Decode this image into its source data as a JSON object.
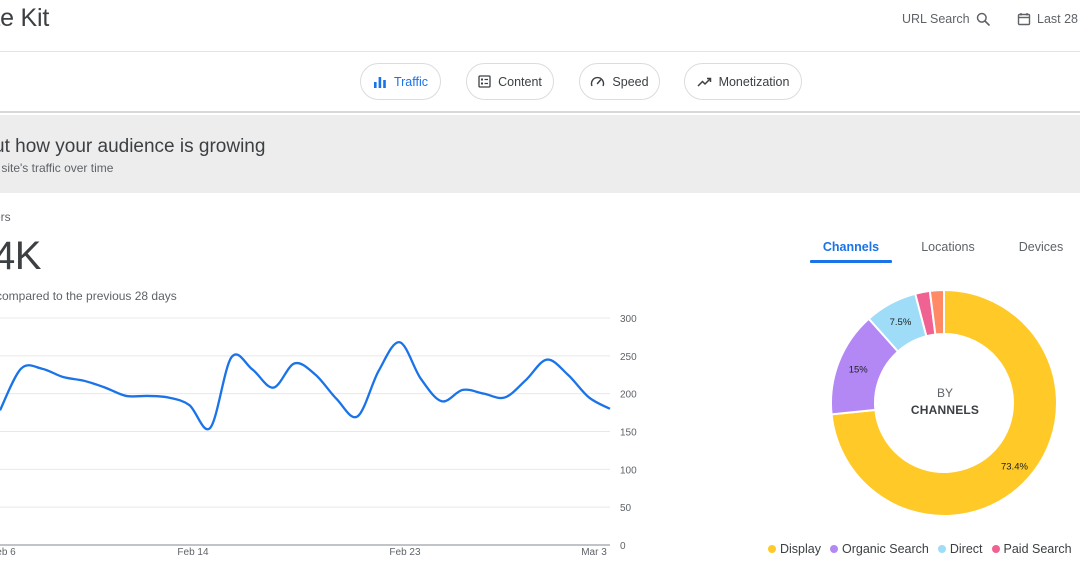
{
  "header": {
    "brand": "ite Kit",
    "url_search_label": "URL Search",
    "date_range_label": "Last 28"
  },
  "nav_tabs": [
    {
      "label": "Traffic",
      "icon": "bar-chart-icon",
      "active": true
    },
    {
      "label": "Content",
      "icon": "content-icon",
      "active": false
    },
    {
      "label": "Speed",
      "icon": "speedometer-icon",
      "active": false
    },
    {
      "label": "Monetization",
      "icon": "trending-up-icon",
      "active": false
    }
  ],
  "banner": {
    "title": "ut how your audience is growing",
    "subtitle": "r site's traffic over time"
  },
  "metric": {
    "label": "ers",
    "value": "4K",
    "compare_text": "compared to the previous 28 days"
  },
  "channel_tabs": [
    {
      "label": "Channels",
      "active": true
    },
    {
      "label": "Locations",
      "active": false
    },
    {
      "label": "Devices",
      "active": false
    }
  ],
  "donut_center": {
    "line1": "BY",
    "line2": "CHANNELS"
  },
  "colors": {
    "accent": "#1a73e8",
    "line": "#1a73e8",
    "display": "#ffca28",
    "organic_search": "#b388f5",
    "direct": "#9fdcf7",
    "paid_search": "#f06292",
    "other": "#ff8a65"
  },
  "chart_data": [
    {
      "type": "line",
      "x_tick_labels": [
        "eb 6",
        "Feb 14",
        "Feb 23",
        "Mar 3"
      ],
      "y_ticks": [
        0,
        50,
        100,
        150,
        200,
        250,
        300
      ],
      "ylim": [
        0,
        300
      ],
      "grid": true,
      "values": [
        178,
        233,
        233,
        222,
        217,
        208,
        197,
        197,
        195,
        185,
        155,
        248,
        232,
        208,
        240,
        225,
        193,
        170,
        230,
        268,
        220,
        190,
        205,
        200,
        195,
        218,
        245,
        225,
        195,
        180
      ]
    },
    {
      "type": "pie",
      "legend_position": "bottom",
      "slices": [
        {
          "name": "Display",
          "value": 73.4,
          "label": "73.4%",
          "color": "#ffca28"
        },
        {
          "name": "Organic Search",
          "value": 15,
          "label": "15%",
          "color": "#b388f5"
        },
        {
          "name": "Direct",
          "value": 7.5,
          "label": "7.5%",
          "color": "#9fdcf7"
        },
        {
          "name": "Paid Search",
          "value": 2.1,
          "label": "",
          "color": "#f06292"
        },
        {
          "name": "",
          "value": 2.0,
          "label": "",
          "color": "#ff8a65"
        }
      ]
    }
  ]
}
